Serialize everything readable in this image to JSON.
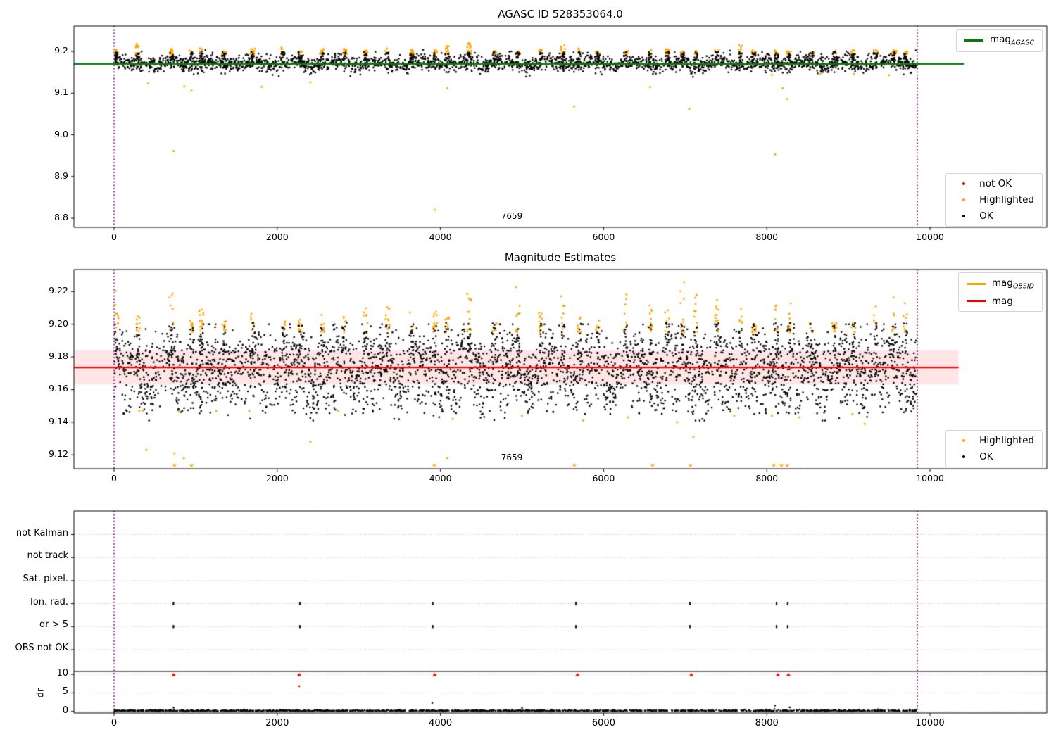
{
  "figure": {
    "background": "#ffffff"
  },
  "colors": {
    "ok": "#000000",
    "highlighted": "#FFA500",
    "not_ok": "#FF0000",
    "mag_agasc_line": "#008000",
    "mag_line": "#FF0000",
    "mag_band": "rgba(255,0,0,0.10)",
    "obsid_boundary": "#800080",
    "grid": "#b8b8b8",
    "spine": "#000000"
  },
  "chart_data": [
    {
      "type": "scatter",
      "title": "AGASC ID 528353064.0",
      "xlim": [
        -492,
        11432
      ],
      "ylim": [
        8.778,
        9.261
      ],
      "xticks": [
        0,
        2000,
        4000,
        6000,
        8000,
        10000
      ],
      "yticks": [
        8.8,
        8.9,
        9.0,
        9.1,
        9.2
      ],
      "ytick_labels": [
        "8.8",
        "8.9",
        "9.0",
        "9.1",
        "9.2"
      ],
      "hline": {
        "y": 9.17,
        "x0": -492,
        "x1": 10420,
        "color": "#008000",
        "label": "mag_AGASC"
      },
      "vlines": [
        0,
        9845
      ],
      "annotation": {
        "text": "7659",
        "x": 4840,
        "y": 8.803
      },
      "noise": {
        "n": 2600,
        "x_min": 5,
        "x_max": 9830,
        "mean": 9.171,
        "std": 0.0095,
        "wave_amp": 0.0045,
        "wave_period": 520,
        "clip": [
          9.139,
          9.204
        ],
        "seed": 11
      },
      "clusters": {
        "x": [
          30,
          290,
          700,
          950,
          1070,
          1350,
          1700,
          2070,
          2280,
          2550,
          2830,
          3080,
          3350,
          3650,
          3930,
          4080,
          4350,
          4660,
          4950,
          5230,
          5500,
          5700,
          5930,
          6270,
          6570,
          6780,
          6970,
          7130,
          7390,
          7680,
          7840,
          8120,
          8270,
          8550,
          8830,
          9060,
          9330,
          9560,
          9700
        ],
        "seed": 21,
        "orange_base": 9.193,
        "peak_min": 9.2,
        "peak_span": 0.022,
        "black_lo": 9.179,
        "black_hi": 9.199
      },
      "outliers_orange": [
        [
          419,
          9.123
        ],
        [
          731,
          8.961
        ],
        [
          860,
          9.116
        ],
        [
          949,
          9.106
        ],
        [
          1810,
          9.115
        ],
        [
          2407,
          9.126
        ],
        [
          3930,
          8.82
        ],
        [
          4086,
          9.112
        ],
        [
          5640,
          9.068
        ],
        [
          6570,
          9.115
        ],
        [
          7050,
          9.062
        ],
        [
          8065,
          9.144
        ],
        [
          8100,
          8.953
        ],
        [
          8194,
          9.112
        ],
        [
          8251,
          9.086
        ],
        [
          8660,
          9.147
        ],
        [
          9066,
          9.146
        ],
        [
          9497,
          9.143
        ]
      ],
      "legend_line": [
        {
          "swatch": "line",
          "color": "#008000",
          "label": "mag",
          "sub": "AGASC"
        }
      ],
      "legend_markers": [
        {
          "swatch": "dot",
          "color": "#FF0000",
          "label": "not OK"
        },
        {
          "swatch": "dot",
          "color": "#FFA500",
          "label": "Highlighted"
        },
        {
          "swatch": "dot",
          "color": "#000000",
          "label": "OK"
        }
      ]
    },
    {
      "type": "scatter",
      "title": "Magnitude Estimates",
      "xlim": [
        -492,
        11432
      ],
      "ylim": [
        9.1115,
        9.2335
      ],
      "xticks": [
        0,
        2000,
        4000,
        6000,
        8000,
        10000
      ],
      "yticks": [
        9.12,
        9.14,
        9.16,
        9.18,
        9.2,
        9.22
      ],
      "ytick_labels": [
        "9.12",
        "9.14",
        "9.16",
        "9.18",
        "9.20",
        "9.22"
      ],
      "hline": {
        "y": 9.1735,
        "x0": -492,
        "x1": 10350,
        "color": "#FF0000",
        "label": "mag"
      },
      "band": {
        "y0": 9.163,
        "y1": 9.184,
        "x0": -492,
        "x1": 10350,
        "color": "rgba(255,0,0,0.10)"
      },
      "vlines": [
        0,
        9845
      ],
      "annotation": {
        "text": "7659",
        "x": 4840,
        "y": 9.1185
      },
      "noise": {
        "n": 3300,
        "x_min": 5,
        "x_max": 9830,
        "mean": 9.1735,
        "std": 0.0105,
        "wave_amp": 0.005,
        "wave_period": 520,
        "clip": [
          9.141,
          9.2
        ],
        "seed": 31
      },
      "clusters": {
        "x": [
          30,
          290,
          700,
          950,
          1070,
          1350,
          1700,
          2070,
          2280,
          2550,
          2830,
          3080,
          3350,
          3650,
          3930,
          4080,
          4350,
          4660,
          4950,
          5230,
          5500,
          5700,
          5930,
          6270,
          6570,
          6780,
          6970,
          7130,
          7390,
          7680,
          7840,
          8120,
          8270,
          8550,
          8830,
          9060,
          9330,
          9560,
          9700
        ],
        "seed": 41,
        "orange_base": 9.195,
        "peak_min": 9.2035,
        "peak_span": 0.024,
        "black_lo": 9.181,
        "black_hi": 9.201,
        "tail_lo": 9.145,
        "tail_hi": 9.158
      },
      "outliers_orange": [
        [
          310,
          9.147
        ],
        [
          354,
          9.147
        ],
        [
          397,
          9.123
        ],
        [
          740,
          9.121
        ],
        [
          794,
          9.147
        ],
        [
          856,
          9.118
        ],
        [
          1251,
          9.147
        ],
        [
          1657,
          9.147
        ],
        [
          2407,
          9.128
        ],
        [
          2743,
          9.147
        ],
        [
          4086,
          9.118
        ],
        [
          4150,
          9.142
        ],
        [
          5000,
          9.144
        ],
        [
          5750,
          9.141
        ],
        [
          6300,
          9.143
        ],
        [
          6900,
          9.14
        ],
        [
          7100,
          9.131
        ],
        [
          7600,
          9.144
        ],
        [
          8065,
          9.144
        ],
        [
          8400,
          9.143
        ],
        [
          9050,
          9.145
        ],
        [
          9200,
          9.139
        ]
      ],
      "clipped_low_x": [
        740,
        950,
        3925,
        5640,
        6601,
        7062,
        8085,
        8180,
        8252
      ],
      "legend_line": [
        {
          "swatch": "line",
          "color": "#FFA500",
          "label": "mag",
          "sub": "OBSID"
        },
        {
          "swatch": "line",
          "color": "#FF0000",
          "label": "mag"
        }
      ],
      "legend_markers": [
        {
          "swatch": "dot",
          "color": "#FFA500",
          "label": "Highlighted"
        },
        {
          "swatch": "dot",
          "color": "#000000",
          "label": "OK"
        }
      ]
    },
    {
      "type": "flags-and-dr",
      "categories": [
        "not Kalman",
        "not track",
        "Sat. pixel.",
        "Ion. rad.",
        "dr > 5",
        "OBS not OK"
      ],
      "xlim": [
        -492,
        11432
      ],
      "xticks": [
        0,
        2000,
        4000,
        6000,
        8000,
        10000
      ],
      "dr_ticks": [
        10,
        5,
        0
      ],
      "dr_label": "dr",
      "separator_dr": 10.8,
      "vlines": [
        0,
        9845
      ],
      "flag_points": [
        {
          "row": 3,
          "x": [
            728,
            2278,
            3905,
            5661,
            7057,
            8119,
            8256
          ]
        },
        {
          "row": 4,
          "x": [
            728,
            2278,
            3905,
            5661,
            7057,
            8119,
            8256
          ]
        }
      ],
      "dr_red_clipped_x": [
        730,
        2270,
        3930,
        5680,
        7075,
        8136,
        8265
      ],
      "dr_red_points": [
        [
          2270,
          6.8
        ]
      ],
      "dr_black_outliers": [
        [
          730,
          1.0
        ],
        [
          3900,
          2.3
        ],
        [
          5000,
          0.9
        ],
        [
          8100,
          1.6
        ],
        [
          8280,
          1.1
        ]
      ],
      "dr_noise": {
        "n": 1600,
        "x_min": 5,
        "x_max": 9830,
        "base": 0.07,
        "spread": 0.16,
        "clip": [
          0.02,
          0.8
        ],
        "seed": 51
      }
    }
  ]
}
